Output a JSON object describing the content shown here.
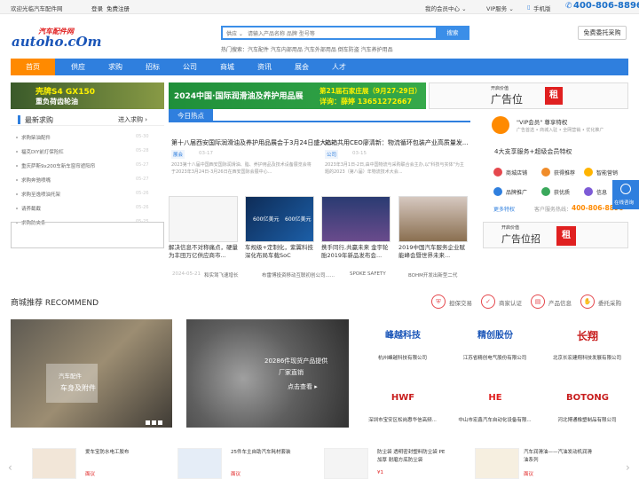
{
  "topbar": {
    "welcome": "欢迎光临汽车配件网",
    "login": "登录",
    "register": "免费注册",
    "member_center": "我的会员中心 ⌄",
    "vip_service": "VIP服务 ⌄",
    "mobile": "手机版",
    "hotline": "400-806-8896"
  },
  "logo": {
    "top": "汽车配件网",
    "main": "autoho.cOm"
  },
  "search": {
    "category": "供应 ⌄",
    "placeholder": "请输入产品名称 品牌 型号等",
    "button": "搜索",
    "hot": "热门搜索：汽车配件 汽车内部用品 汽车外部用品 倒车防盗 汽车养护用品"
  },
  "free_button": "免费委托采购",
  "nav": [
    "首页",
    "供应",
    "求购",
    "招标",
    "公司",
    "商城",
    "资讯",
    "展会",
    "人才"
  ],
  "banners": {
    "b1_line1": "壳牌S4 GX150",
    "b1_line2": "重负荷齿轮油",
    "b2_line1": "2024中国·国际润滑油及养护用品展",
    "b2_line2": "第21届石家庄展（9月27-29日）",
    "b2_line3": "详询：薛婷 13651272667",
    "b3_small": "开启价值",
    "b3_big": "广告位",
    "b3_red": "租"
  },
  "latest": {
    "title": "最新求购",
    "more": "进入求购 ›",
    "items": [
      {
        "text": "求购柴油配件",
        "date": "05-30"
      },
      {
        "text": "福克DIY前灯保险杠",
        "date": "05-28"
      },
      {
        "text": "重庆萨斯9x200车新车窗帘遮阳帘",
        "date": "05-27"
      },
      {
        "text": "求购奔驰喷嘴",
        "date": "05-27"
      },
      {
        "text": "求购至逸喷油托架",
        "date": "05-26"
      },
      {
        "text": "请养截截",
        "date": "05-26"
      },
      {
        "text": "求购防夹条",
        "date": "05-25"
      }
    ]
  },
  "hot": {
    "tab": "今日热点",
    "news": [
      {
        "title": "第十八届西安国际润滑油及养护用品展会于3月24日盛大...",
        "tag": "展会",
        "date": "03-17",
        "desc": "2023第十八届中国西安国际润滑油、脂、养护用品及技术设备展览会将于2023年3月24日-3月26日在西安国际会展中心..."
      },
      {
        "title": "箱箱共用CEO廖清新：物流循环包装产业高质量发...",
        "tag": "公司",
        "date": "03-15",
        "desc": "2023年3月1日-2日,由中国物流与采购联合会主办,以\"科技与实体\"为主题的2023（第八届）年物流技术大会..."
      }
    ],
    "thumbs": [
      {
        "caption": "解决信息不对称痛点，硬量为丰田万亿供应商市..."
      },
      {
        "caption": "车规级+定制化，紫翼科技深化布局车载SoC"
      },
      {
        "caption": "携手同行,共赢未来 金宇轮胎2019年新品发布会..."
      },
      {
        "caption": "2019中国汽车服务企业赋能峰会暨世界未来..."
      }
    ],
    "thumb_labels": {
      "t2a": "600亿美元",
      "t2b": "600亿美元"
    },
    "ticker": [
      {
        "date": "2024-05-21",
        "text": "和实驾飞速增长"
      },
      {
        "text": "布雷博投资移动互联初创公司......"
      },
      {
        "text": "SPOKE SAFETY"
      },
      {
        "text": "BOHM开发出新型二代"
      }
    ]
  },
  "vip": {
    "title": "\"VIP会员\" 尊享特权",
    "sub": "广告首选 • 商城入驻 • 全网营销 • 优化推广",
    "desc": "4大支享服务+超级会员特权",
    "cells": [
      "商城店铺",
      "获得推荐",
      "智能营销",
      "品牌推广",
      "获优质",
      "信息",
      "广告",
      "关关"
    ],
    "more": "更多特权",
    "service": "客户服务热线：",
    "phone": "400-806-8896"
  },
  "chat": {
    "label": "在线咨询"
  },
  "b4": {
    "small": "开启价值",
    "big": "广告位招",
    "red": "租"
  },
  "recommend": {
    "title": "商城推荐 RECOMMEND",
    "badges": [
      "担保交易",
      "商家认证",
      "产品信息",
      "委托采购"
    ]
  },
  "mall": {
    "m1a": "汽车配件",
    "m1b": "车身及附件",
    "m2a": "20286件现货产品提供",
    "m2b": "厂家直销",
    "m2c": "点击查看 ▸"
  },
  "brands": [
    {
      "logo": "峰越科技",
      "name": "杭州峰越科技有限公司",
      "color": "#1a55b8"
    },
    {
      "logo": "精创股份",
      "name": "江苏省精创电气股份有限公司",
      "color": "#1a55b8"
    },
    {
      "logo": "长翔",
      "name": "北京长宏建翔科技发展有限公司",
      "color": "#c81e1e"
    },
    {
      "logo": "HWF",
      "name": "深圳市宝安区松岗惠华信高频...",
      "color": "#c81e1e"
    },
    {
      "logo": "HE",
      "name": "中山市宏鑫汽车自动化设备有限...",
      "color": "#e02020"
    },
    {
      "logo": "BOTONG",
      "name": "河北博通橡塑制品有限公司",
      "color": "#c81e1e"
    }
  ],
  "products": [
    {
      "name": "爱车宝防水电工胶布",
      "price": "面议"
    },
    {
      "name": "25件车主自助汽车耗材套装",
      "price": "面议"
    },
    {
      "name": "防尘袋 透明密封塑料防尘袋 PE加厚 耐磨方底防尘袋",
      "price": "¥1"
    },
    {
      "name": "",
      "price": "面议"
    },
    {
      "name": "汽车润滑油——汽油发动机润滑油系列",
      "price": "面议"
    }
  ]
}
